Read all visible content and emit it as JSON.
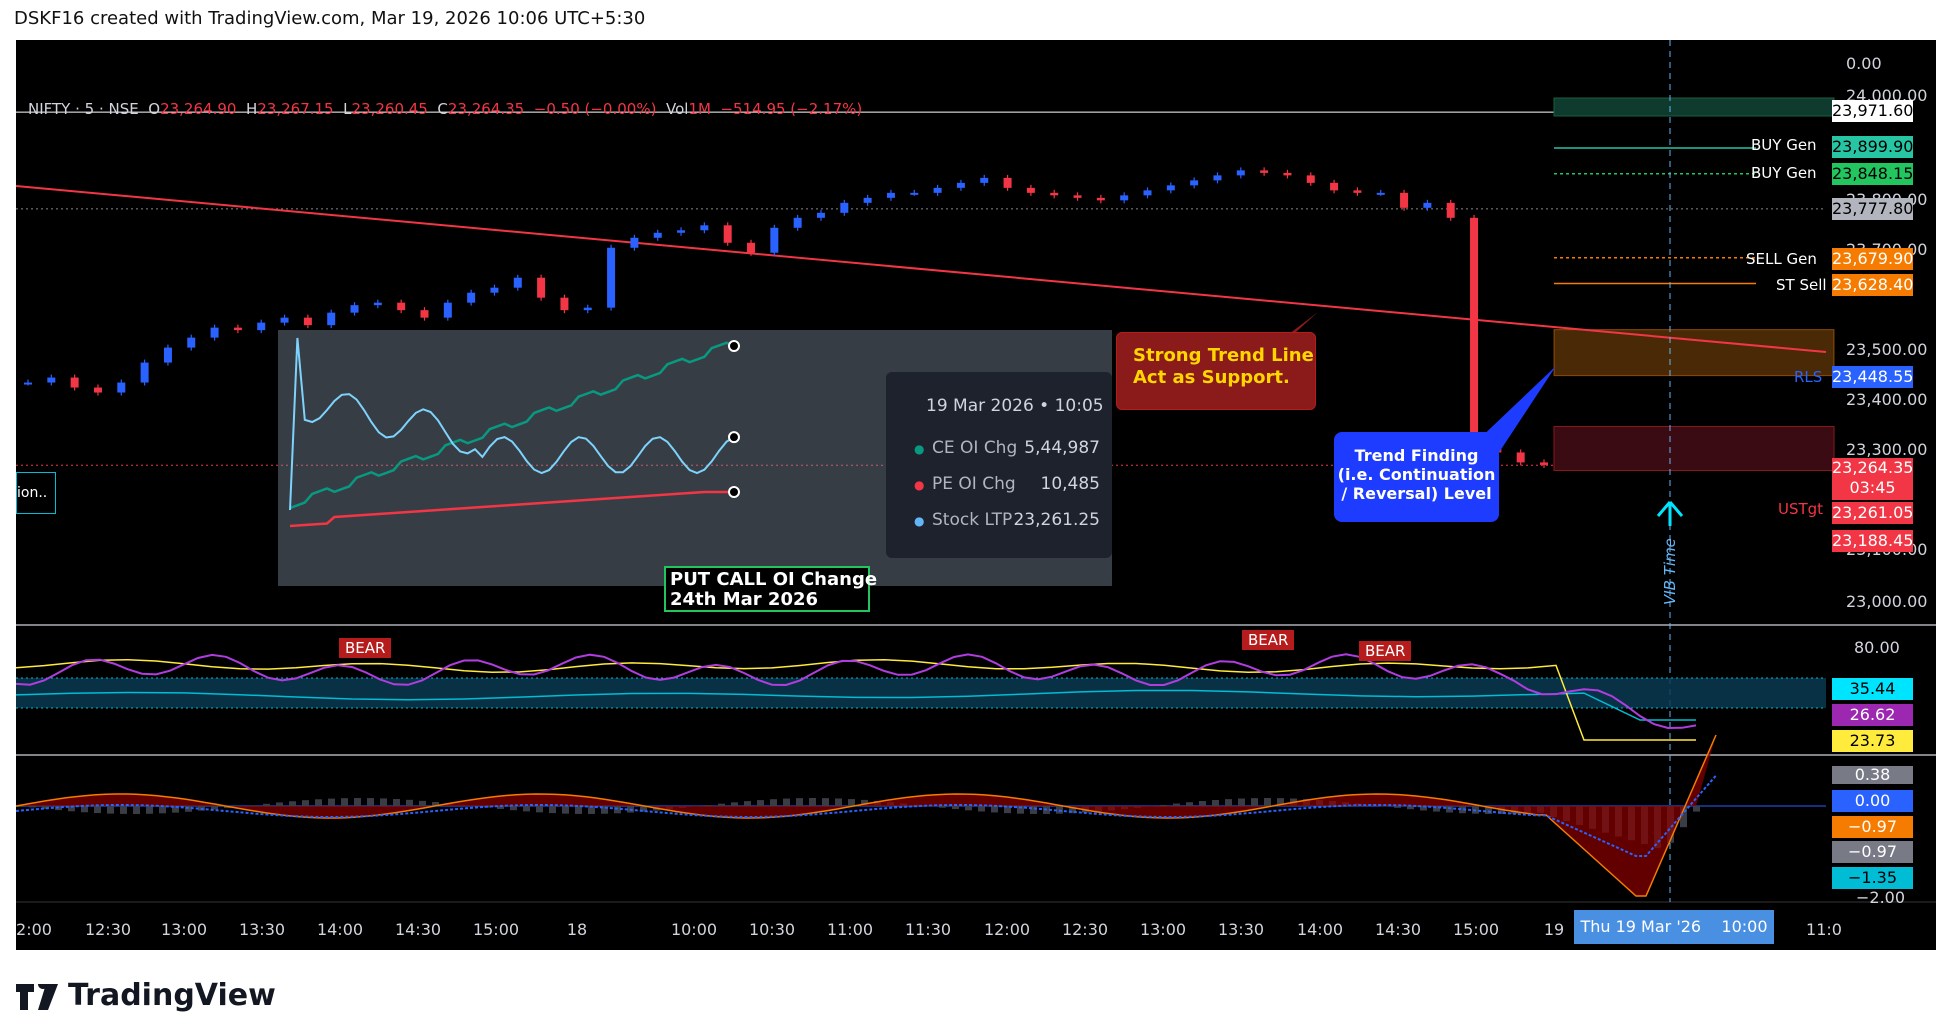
{
  "header": {
    "text": "DSKF16 created with TradingView.com, Mar 19, 2026 10:06 UTC+5:30"
  },
  "footer": {
    "logo_text": "TradingView",
    "logo_icon": "tradingview-logo-icon"
  },
  "ohlc": {
    "symbol": "NIFTY · 5 · NSE",
    "o_label": "O",
    "o_value": "23,264.90",
    "h_label": "H",
    "h_value": "23,267.15",
    "l_label": "L",
    "l_value": "23,260.45",
    "c_label": "C",
    "c_value": "23,264.35",
    "change": "−0.50 (−0.00%)",
    "vol_label": "Vol",
    "vol_value": "1M",
    "vol_change": "−514.95 (−2.17%)"
  },
  "colors": {
    "up": "#2962ff",
    "down": "#f23645",
    "background": "#000000",
    "trend_line": "#f23645"
  },
  "price_axis": {
    "ticks": [
      "0.00",
      "24,000.00",
      "23,800.00",
      "23,700.00",
      "23,500.00",
      "23,400.00",
      "23,300.00",
      "23,100.00",
      "23,000.00"
    ]
  },
  "time_axis": {
    "ticks": [
      "2:00",
      "12:30",
      "13:00",
      "13:30",
      "14:00",
      "14:30",
      "15:00",
      "18",
      "10:00",
      "10:30",
      "11:00",
      "11:30",
      "12:00",
      "12:30",
      "13:00",
      "13:30",
      "14:00",
      "14:30",
      "15:00",
      "19",
      "11:0"
    ],
    "crosshair_label": "Thu 19 Mar '26    10:00"
  },
  "levels": [
    {
      "name": "",
      "value": "23,971.60",
      "color": "#ffffff",
      "text_color": "#000000"
    },
    {
      "name": "BUY Gen",
      "value": "23,899.90",
      "color": "#26c6a4",
      "text_color": "#000000"
    },
    {
      "name": "BUY Gen",
      "value": "23,848.15",
      "color": "#22c55e",
      "text_color": "#000000"
    },
    {
      "name": "",
      "value": "23,777.80",
      "color": "#b2b5be",
      "text_color": "#000000"
    },
    {
      "name": "SELL Gen",
      "value": "23,679.90",
      "color": "#f57c00",
      "text_color": "#ffffff"
    },
    {
      "name": "ST Sell",
      "value": "23,628.40",
      "color": "#f57c00",
      "text_color": "#ffffff"
    },
    {
      "name": "RLS",
      "value": "23,448.55",
      "color": "#2962ff",
      "text_color": "#ffffff"
    },
    {
      "name": "",
      "value": "23,264.35",
      "color": "#f23645",
      "text_color": "#ffffff",
      "extra": "03:45"
    },
    {
      "name": "USTgt",
      "value": "23,261.05",
      "color": "#f23645",
      "text_color": "#ffffff"
    },
    {
      "name": "",
      "value": "23,188.45",
      "color": "#f23645",
      "text_color": "#ffffff"
    }
  ],
  "oscillator": {
    "axis_top": "80.00",
    "values": [
      "35.44",
      "26.62",
      "23.73"
    ],
    "value_colors": [
      "#00e5ff",
      "#9c27b0",
      "#ffeb3b"
    ],
    "bear_labels": [
      "BEAR",
      "BEAR",
      "BEAR"
    ]
  },
  "macd": {
    "values": [
      "0.38",
      "0.00",
      "−0.97",
      "−0.97",
      "−1.35"
    ],
    "value_colors": [
      "#787b86",
      "#2962ff",
      "#f57c00",
      "#787b86",
      "#00bcd4"
    ],
    "axis_bottom": "−2.00"
  },
  "annotations": {
    "trend_line_note": "Strong Trend Line\nAct as Support.",
    "trend_finding_note": "Trend Finding\n(i.e. Continuation\n/ Reversal) Level",
    "vib_time": "VIB Time",
    "left_cutoff": "ion.."
  },
  "inset": {
    "caption_line1": "PUT CALL OI Change",
    "caption_line2": "24th Mar 2026",
    "tooltip_date": "19 Mar 2026 • 10:05",
    "rows": [
      {
        "label": "CE OI Chg",
        "value": "5,44,987",
        "color": "#089981"
      },
      {
        "label": "PE OI Chg",
        "value": "10,485",
        "color": "#f23645"
      },
      {
        "label": "Stock LTP",
        "value": "23,261.25",
        "color": "#64b5f6"
      }
    ]
  },
  "chart_data": {
    "type": "candlestick",
    "title": "",
    "series": [
      {
        "name": "NIFTY 5m close (approx)",
        "values": [
          23430,
          23440,
          23420,
          23410,
          23430,
          23470,
          23500,
          23520,
          23540,
          23535,
          23550,
          23560,
          23545,
          23570,
          23585,
          23590,
          23575,
          23560,
          23590,
          23610,
          23620,
          23640,
          23600,
          23575,
          23580,
          23700,
          23720,
          23730,
          23735,
          23745,
          23710,
          23690,
          23740,
          23760,
          23770,
          23790,
          23800,
          23810,
          23810,
          23820,
          23830,
          23840,
          23820,
          23810,
          23805,
          23800,
          23795,
          23805,
          23815,
          23825,
          23835,
          23845,
          23855,
          23850,
          23845,
          23830,
          23815,
          23810,
          23810,
          23780,
          23790,
          23760,
          23330,
          23290,
          23270,
          23265
        ]
      }
    ],
    "ylim": [
      23000,
      24050
    ]
  }
}
